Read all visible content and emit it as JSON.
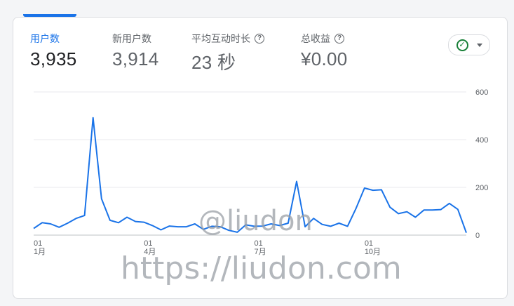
{
  "metrics": [
    {
      "label": "用户数",
      "value": "3,935",
      "active": true,
      "help": false
    },
    {
      "label": "新用户数",
      "value": "3,914",
      "active": false,
      "help": false
    },
    {
      "label": "平均互动时长",
      "value": "23 秒",
      "active": false,
      "help": true
    },
    {
      "label": "总收益",
      "value": "¥0.00",
      "active": false,
      "help": true
    }
  ],
  "status_icon": "check-circle-icon",
  "dropdown_icon": "caret-down-icon",
  "watermark": {
    "handle": "@liudon",
    "url": "https://liudon.com"
  },
  "colors": {
    "accent": "#1a73e8",
    "line": "#1a73e8",
    "check": "#188038"
  },
  "chart_data": {
    "type": "line",
    "title": "",
    "xlabel": "",
    "ylabel": "",
    "ylim": [
      0,
      600
    ],
    "y_ticks": [
      "0",
      "200",
      "400",
      "600"
    ],
    "x_ticks": [
      {
        "day": "01",
        "month": "1月",
        "index": 0
      },
      {
        "day": "01",
        "month": "4月",
        "index": 13
      },
      {
        "day": "01",
        "month": "7月",
        "index": 26
      },
      {
        "day": "01",
        "month": "10月",
        "index": 39
      }
    ],
    "grid": true,
    "series": [
      {
        "values": [
          28,
          52,
          47,
          33,
          50,
          70,
          82,
          492,
          152,
          62,
          52,
          75,
          57,
          54,
          40,
          22,
          38,
          35,
          35,
          47,
          24,
          37,
          35,
          20,
          12,
          43,
          37,
          38,
          47,
          40,
          50,
          225,
          35,
          70,
          45,
          37,
          50,
          37,
          112,
          197,
          188,
          190,
          117,
          90,
          98,
          75,
          105,
          105,
          107,
          133,
          108,
          10
        ]
      }
    ]
  }
}
